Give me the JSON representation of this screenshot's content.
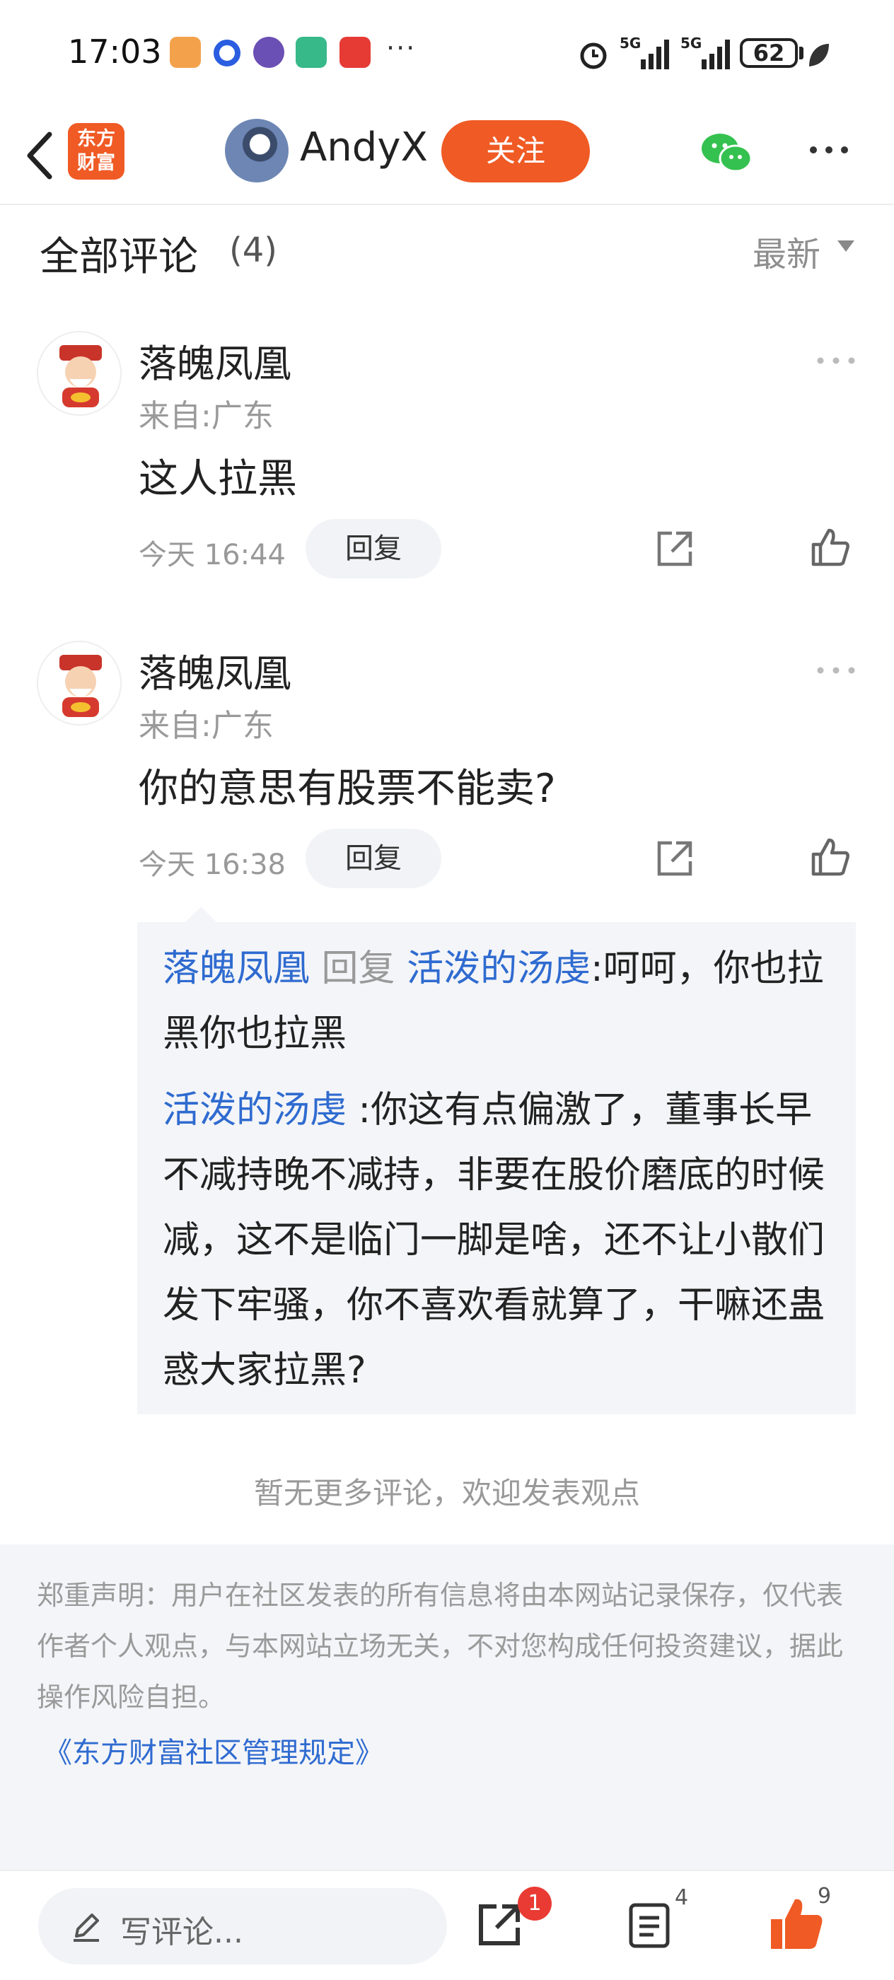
{
  "status_bar": {
    "time": "17:03",
    "battery": "62",
    "overflow": "···",
    "network": "5G"
  },
  "nav": {
    "logo_text_line1": "东方",
    "logo_text_line2": "财富",
    "username": "AndyX",
    "follow_label": "关注"
  },
  "comments_header": {
    "title": "全部评论",
    "count": "(4)",
    "sort_label": "最新"
  },
  "comments": [
    {
      "name": "落魄凤凰",
      "location": "来自:广东",
      "text": "这人拉黑",
      "time": "今天 16:44",
      "reply_label": "回复"
    },
    {
      "name": "落魄凤凰",
      "location": "来自:广东",
      "text": "你的意思有股票不能卖?",
      "time": "今天 16:38",
      "reply_label": "回复"
    }
  ],
  "sub_replies": [
    {
      "author": "落魄凤凰",
      "reply_word": "回复",
      "target": "活泼的汤虔",
      "text": ":呵呵，你也拉黑你也拉黑"
    },
    {
      "author": "活泼的汤虔",
      "text": ":你这有点偏激了，董事长早不减持晚不减持，非要在股价磨底的时候减，这不是临门一脚是啥，还不让小散们发下牢骚，你不喜欢看就算了，干嘛还蛊惑大家拉黑?"
    }
  ],
  "no_more": "暂无更多评论，欢迎发表观点",
  "disclaimer": {
    "text": "郑重声明：用户在社区发表的所有信息将由本网站记录保存，仅代表作者个人观点，与本网站立场无关，不对您构成任何投资建议，据此操作风险自担。",
    "link": "《东方财富社区管理规定》"
  },
  "bottom_bar": {
    "placeholder": "写评论...",
    "share_badge": "1",
    "list_count": "4",
    "like_count": "9"
  },
  "colors": {
    "accent": "#f05a24",
    "link": "#2f6bd0",
    "badge": "#e93b33"
  }
}
